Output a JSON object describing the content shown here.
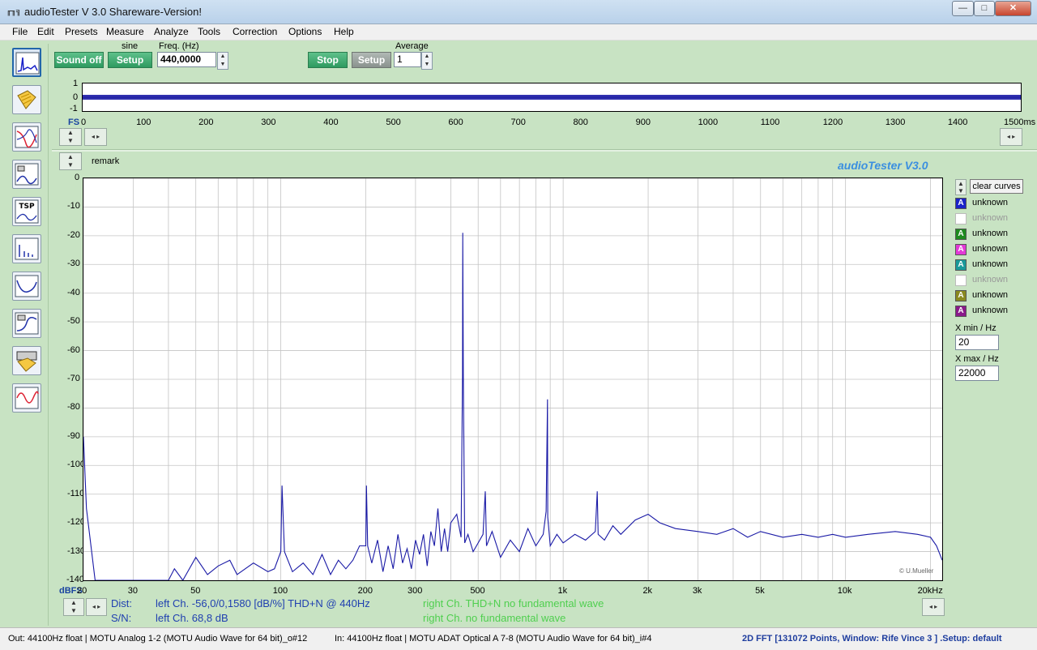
{
  "window": {
    "title": "audioTester  V 3.0 Shareware-Version!",
    "minimize": "—",
    "maximize": "□",
    "close": "✕"
  },
  "menu": [
    "File",
    "Edit",
    "Presets",
    "Measure",
    "Analyze",
    "Tools",
    "Correction",
    "Options",
    "Help"
  ],
  "toolbar_icons": [
    "fft-spectrum-icon",
    "file-open-icon",
    "frequency-response-icon",
    "impedance-icon",
    "tsp-icon",
    "distortion-icon",
    "filter-icon",
    "loudspeaker-icon",
    "files-icon",
    "oscilloscope-icon"
  ],
  "tsp_label": "TSP",
  "generator": {
    "sound_button": "Sound off",
    "waveform_label": "sine",
    "setup_button": "Setup",
    "freq_label": "Freq. (Hz)",
    "freq_value": "440,0000"
  },
  "analyzer": {
    "stop_button": "Stop",
    "setup_button": "Setup",
    "average_label": "Average",
    "average_value": "1"
  },
  "scope": {
    "y_ticks": [
      "1",
      "0",
      "-1"
    ],
    "fs_label": "FS",
    "x_ticks": [
      "0",
      "100",
      "200",
      "300",
      "400",
      "500",
      "600",
      "700",
      "800",
      "900",
      "1000",
      "1100",
      "1200",
      "1300",
      "1400",
      "1500ms"
    ]
  },
  "plot": {
    "remark_label": "remark",
    "brand_title": "audioTester  V3.0",
    "copyright": "© U.Mueller",
    "y_unit": "dBFS",
    "x_unit_last": "20kHz"
  },
  "legend": {
    "clear_curves": "clear curves",
    "swatch_letter": "A",
    "items": [
      {
        "label": "unknown",
        "color": "#1a22c8",
        "enabled": true
      },
      {
        "label": "unknown",
        "color": "#bbbbbb",
        "enabled": false
      },
      {
        "label": "unknown",
        "color": "#1e8a1e",
        "enabled": true
      },
      {
        "label": "unknown",
        "color": "#e23ad6",
        "enabled": true
      },
      {
        "label": "unknown",
        "color": "#1a9a9a",
        "enabled": true
      },
      {
        "label": "unknown",
        "color": "#bbbbbb",
        "enabled": false
      },
      {
        "label": "unknown",
        "color": "#8a8a20",
        "enabled": true
      },
      {
        "label": "unknown",
        "color": "#8a1a8a",
        "enabled": true
      }
    ],
    "xmin_label": "X min / Hz",
    "xmin_value": "20",
    "xmax_label": "X max / Hz",
    "xmax_value": "22000"
  },
  "readouts": {
    "dist_label": "Dist:",
    "dist_value": "left Ch. -56,0/0,1580 [dB/%] THD+N  @ 440Hz",
    "sn_label": "S/N:",
    "sn_value": "left Ch. 68,8 dB",
    "right_dist": "right Ch. THD+N  no fundamental wave",
    "right_sn": "right Ch.  no fundamental wave"
  },
  "status": {
    "out": "Out: 44100Hz float  | MOTU Analog 1-2 (MOTU Audio Wave for 64 bit)_o#12",
    "in": "In: 44100Hz float  | MOTU ADAT Optical A 7-8 (MOTU Audio Wave for 64 bit)_i#4",
    "mode": "2D FFT [131072 Points, Window: Rife Vince 3 ]  .Setup:  default"
  },
  "colors": {
    "background": "#c8e3c3",
    "trace": "#1a1aa6",
    "accent_title": "#3b8fe0",
    "readout_blue": "#1f3fb0",
    "readout_green": "#4fcf4f"
  },
  "chart_data": {
    "type": "line",
    "title": "",
    "xlabel": "",
    "ylabel": "dBFS",
    "x_scale": "log",
    "xlim": [
      20,
      22000
    ],
    "ylim": [
      -140,
      0
    ],
    "x_ticks": [
      {
        "value": 20,
        "label": "20"
      },
      {
        "value": 30,
        "label": "30"
      },
      {
        "value": 50,
        "label": "50"
      },
      {
        "value": 100,
        "label": "100"
      },
      {
        "value": 200,
        "label": "200"
      },
      {
        "value": 300,
        "label": "300"
      },
      {
        "value": 500,
        "label": "500"
      },
      {
        "value": 1000,
        "label": "1k"
      },
      {
        "value": 2000,
        "label": "2k"
      },
      {
        "value": 3000,
        "label": "3k"
      },
      {
        "value": 5000,
        "label": "5k"
      },
      {
        "value": 10000,
        "label": "10k"
      },
      {
        "value": 20000,
        "label": "20kHz"
      }
    ],
    "y_ticks": [
      0,
      -10,
      -20,
      -30,
      -40,
      -50,
      -60,
      -70,
      -80,
      -90,
      -100,
      -110,
      -120,
      -130,
      -140
    ],
    "grid": true,
    "series": [
      {
        "color": "#1a1aa6",
        "points": [
          [
            20,
            -90
          ],
          [
            20.5,
            -115
          ],
          [
            22,
            -140
          ],
          [
            30,
            -140
          ],
          [
            40,
            -140
          ],
          [
            42,
            -136
          ],
          [
            45,
            -140
          ],
          [
            50,
            -132
          ],
          [
            55,
            -138
          ],
          [
            60,
            -135
          ],
          [
            66,
            -133
          ],
          [
            70,
            -138
          ],
          [
            80,
            -134
          ],
          [
            90,
            -137
          ],
          [
            95,
            -136
          ],
          [
            100,
            -130
          ],
          [
            101,
            -107
          ],
          [
            103,
            -130
          ],
          [
            110,
            -137
          ],
          [
            120,
            -134
          ],
          [
            130,
            -138
          ],
          [
            140,
            -131
          ],
          [
            150,
            -138
          ],
          [
            160,
            -133
          ],
          [
            170,
            -136
          ],
          [
            180,
            -133
          ],
          [
            190,
            -128
          ],
          [
            200,
            -128
          ],
          [
            201,
            -107
          ],
          [
            203,
            -128
          ],
          [
            210,
            -134
          ],
          [
            220,
            -126
          ],
          [
            230,
            -137
          ],
          [
            240,
            -128
          ],
          [
            250,
            -136
          ],
          [
            260,
            -124
          ],
          [
            270,
            -134
          ],
          [
            280,
            -129
          ],
          [
            290,
            -136
          ],
          [
            300,
            -126
          ],
          [
            310,
            -131
          ],
          [
            320,
            -124
          ],
          [
            330,
            -135
          ],
          [
            340,
            -123
          ],
          [
            350,
            -128
          ],
          [
            360,
            -115
          ],
          [
            370,
            -130
          ],
          [
            380,
            -122
          ],
          [
            390,
            -130
          ],
          [
            400,
            -120
          ],
          [
            420,
            -117
          ],
          [
            435,
            -125
          ],
          [
            440,
            -69
          ],
          [
            441,
            -19
          ],
          [
            443,
            -69
          ],
          [
            448,
            -127
          ],
          [
            460,
            -124
          ],
          [
            480,
            -130
          ],
          [
            500,
            -127
          ],
          [
            520,
            -124
          ],
          [
            530,
            -109
          ],
          [
            535,
            -128
          ],
          [
            560,
            -123
          ],
          [
            600,
            -132
          ],
          [
            650,
            -126
          ],
          [
            700,
            -130
          ],
          [
            750,
            -122
          ],
          [
            800,
            -128
          ],
          [
            850,
            -124
          ],
          [
            870,
            -116
          ],
          [
            880,
            -77
          ],
          [
            882,
            -118
          ],
          [
            900,
            -128
          ],
          [
            950,
            -124
          ],
          [
            1000,
            -127
          ],
          [
            1100,
            -124
          ],
          [
            1200,
            -126
          ],
          [
            1300,
            -123
          ],
          [
            1320,
            -109
          ],
          [
            1330,
            -124
          ],
          [
            1400,
            -126
          ],
          [
            1500,
            -121
          ],
          [
            1600,
            -124
          ],
          [
            1800,
            -119
          ],
          [
            2000,
            -117
          ],
          [
            2200,
            -120
          ],
          [
            2500,
            -122
          ],
          [
            3000,
            -123
          ],
          [
            3500,
            -124
          ],
          [
            4000,
            -122
          ],
          [
            4500,
            -125
          ],
          [
            5000,
            -123
          ],
          [
            6000,
            -125
          ],
          [
            7000,
            -124
          ],
          [
            8000,
            -125
          ],
          [
            9000,
            -124
          ],
          [
            10000,
            -125
          ],
          [
            12000,
            -124
          ],
          [
            15000,
            -123
          ],
          [
            18000,
            -124
          ],
          [
            20000,
            -125
          ],
          [
            21000,
            -128
          ],
          [
            22000,
            -133
          ]
        ]
      }
    ]
  }
}
